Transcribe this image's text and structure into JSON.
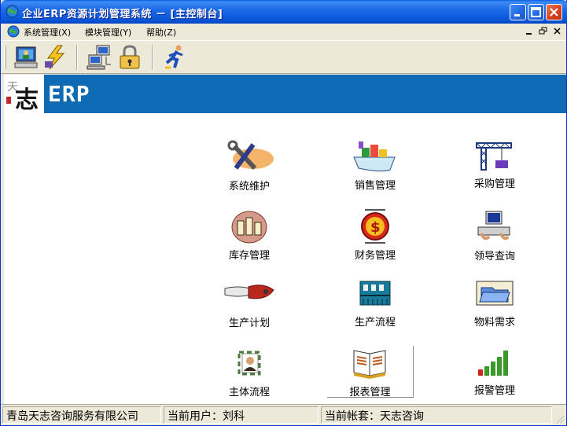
{
  "window": {
    "title": "企业ERP资源计划管理系统 － [主控制台]"
  },
  "menu": {
    "items": [
      "系统管理(X)",
      "模块管理(Y)",
      "帮助(Z)"
    ]
  },
  "toolbar": {
    "buttons": [
      "monitor-user-icon",
      "lightning-icon",
      "network-computers-icon",
      "lock-icon",
      "running-man-icon"
    ]
  },
  "banner": {
    "logo_char": "志",
    "logo_small": "天",
    "brand": "ERP"
  },
  "modules": [
    {
      "label": "系统维护",
      "icon": "tools-icon"
    },
    {
      "label": "销售管理",
      "icon": "cargo-ship-icon"
    },
    {
      "label": "采购管理",
      "icon": "crane-icon"
    },
    {
      "label": "库存管理",
      "icon": "warehouse-icon"
    },
    {
      "label": "财务管理",
      "icon": "dollar-coin-icon"
    },
    {
      "label": "领导查询",
      "icon": "computer-keyboard-icon"
    },
    {
      "label": "生产计划",
      "icon": "screwdriver-icon"
    },
    {
      "label": "生产流程",
      "icon": "factory-icon"
    },
    {
      "label": "物料需求",
      "icon": "folder-icon"
    },
    {
      "label": "主体流程",
      "icon": "person-cycle-icon"
    },
    {
      "label": "报表管理",
      "icon": "open-book-icon"
    },
    {
      "label": "报警管理",
      "icon": "signal-bars-icon"
    }
  ],
  "status": {
    "company": "青岛天志咨询服务有限公司",
    "user": "当前用户：刘科",
    "account": "当前帐套：天志咨询"
  }
}
